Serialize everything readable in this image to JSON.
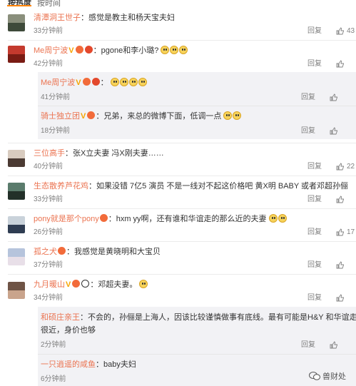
{
  "tabs": [
    "按热度",
    "按时间"
  ],
  "actions": {
    "reply": "回复"
  },
  "comments": [
    {
      "user": "清潭洞王世子",
      "text": "感觉是教主和杨天宝夫妇",
      "time": "33分钟前",
      "likes": "43"
    },
    {
      "user": "Me周宁波",
      "text": "pgone和李小璐?",
      "time": "42分钟前",
      "likes": ""
    },
    {
      "user": "Me周宁波",
      "text": "",
      "time": "41分钟前",
      "likes": ""
    },
    {
      "user": "骑士独立团",
      "text": "兄弟，来总的微博下面，低调一点",
      "time": "18分钟前",
      "likes": ""
    },
    {
      "user": "三位高手",
      "text": "张X立夫妻 冯X刚夫妻……",
      "time": "40分钟前",
      "likes": "22"
    },
    {
      "user": "生态散养芦花鸡",
      "text": "如果没错 7亿5 演员 不是一线对不起这价格吧 黄X明 BABY 或者邓超孙俪",
      "time": "33分钟前",
      "likes": ""
    },
    {
      "user": "pony就是那个pony",
      "text": "hxm yy啊，还有谁和华谊走的那么近的夫妻",
      "time": "26分钟前",
      "likes": "17"
    },
    {
      "user": "孤之犬",
      "text": "我感觉是黄晓明和大宝贝",
      "time": "37分钟前",
      "likes": ""
    },
    {
      "user": "九月暖山",
      "text": "邓超夫妻。",
      "time": "34分钟前",
      "likes": ""
    },
    {
      "user": "和硕庄亲王",
      "text": "不会的，孙俪是上海人，因该比较谨慎做事有底线。最有可能是H&Y 和华谊走的很近，身价也够",
      "text_line1": "不会的，孙俪是上海人，因该比较谨慎做事有底线。最有可能是H&Y 和华谊走的",
      "text_line2": "很近，身价也够",
      "time": "2分钟前",
      "likes": ""
    },
    {
      "user": "一只逍遥的咸鱼",
      "text": "baby夫妇",
      "time": "6分钟前",
      "likes": ""
    }
  ],
  "colors": {
    "username": "#eb7350",
    "accent": "#ff8200",
    "reply_bg": "#f2f2f5"
  },
  "icons": [
    "thumb-up-icon",
    "smiley-emoji-icon",
    "vip-v-icon",
    "wechat-icon"
  ],
  "watermark": "兽财处"
}
